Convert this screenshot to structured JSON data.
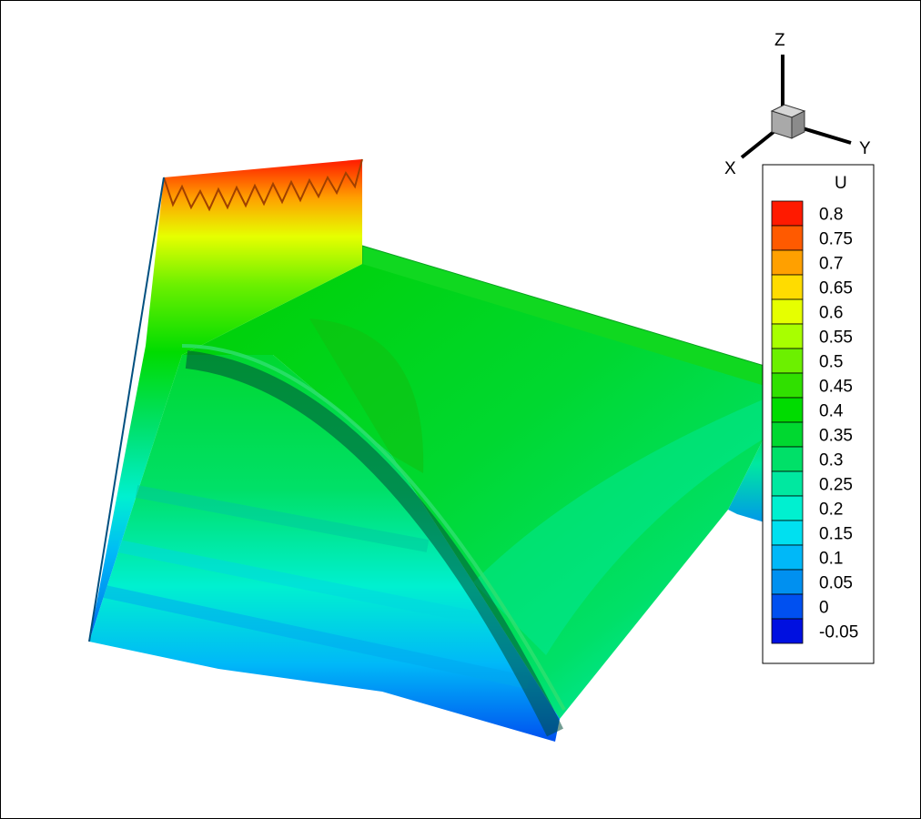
{
  "chart_data": {
    "type": "contour-surface-3d",
    "variable": "U",
    "legend": {
      "title": "U",
      "placement": "right",
      "levels": [
        {
          "label": "0.8",
          "value": 0.8,
          "color": "#ff1a00"
        },
        {
          "label": "0.75",
          "value": 0.75,
          "color": "#ff5a00"
        },
        {
          "label": "0.7",
          "value": 0.7,
          "color": "#ffa000"
        },
        {
          "label": "0.65",
          "value": 0.65,
          "color": "#ffdc00"
        },
        {
          "label": "0.6",
          "value": 0.6,
          "color": "#e6ff00"
        },
        {
          "label": "0.55",
          "value": 0.55,
          "color": "#a8ff00"
        },
        {
          "label": "0.5",
          "value": 0.5,
          "color": "#6cf000"
        },
        {
          "label": "0.45",
          "value": 0.45,
          "color": "#30e000"
        },
        {
          "label": "0.4",
          "value": 0.4,
          "color": "#00dc00"
        },
        {
          "label": "0.35",
          "value": 0.35,
          "color": "#00d830"
        },
        {
          "label": "0.3",
          "value": 0.3,
          "color": "#00e068"
        },
        {
          "label": "0.25",
          "value": 0.25,
          "color": "#00e8a0"
        },
        {
          "label": "0.2",
          "value": 0.2,
          "color": "#00f0d0"
        },
        {
          "label": "0.15",
          "value": 0.15,
          "color": "#00e0f0"
        },
        {
          "label": "0.1",
          "value": 0.1,
          "color": "#00b8f8"
        },
        {
          "label": "0.05",
          "value": 0.05,
          "color": "#0090f0"
        },
        {
          "label": "0",
          "value": 0,
          "color": "#0050f0"
        },
        {
          "label": "-0.05",
          "value": -0.05,
          "color": "#0010e0"
        }
      ]
    },
    "axes_triad": {
      "x_label": "X",
      "y_label": "Y",
      "z_label": "Z"
    }
  }
}
